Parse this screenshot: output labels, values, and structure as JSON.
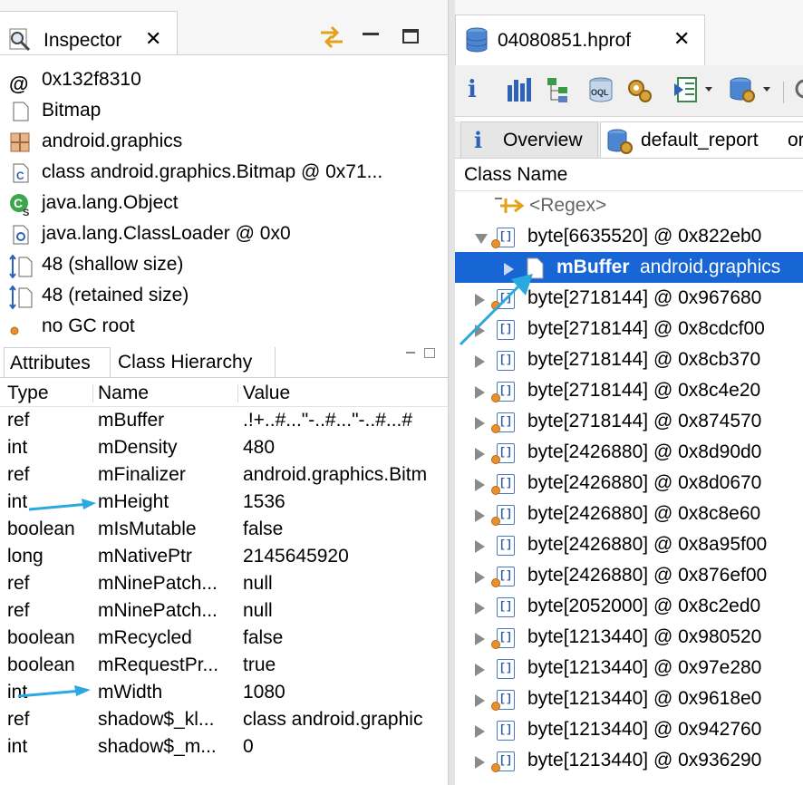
{
  "inspector": {
    "tab_title": "Inspector",
    "object_info": [
      {
        "icon": "at-icon",
        "text": "0x132f8310"
      },
      {
        "icon": "file-icon",
        "text": "Bitmap"
      },
      {
        "icon": "package-icon",
        "text": "android.graphics"
      },
      {
        "icon": "class-file-icon",
        "text": "class android.graphics.Bitmap @ 0x71..."
      },
      {
        "icon": "superclass-icon",
        "text": "java.lang.Object"
      },
      {
        "icon": "classloader-icon",
        "text": "java.lang.ClassLoader @ 0x0"
      },
      {
        "icon": "shallow-size-icon",
        "text": "48 (shallow size)"
      },
      {
        "icon": "retained-size-icon",
        "text": "48 (retained size)"
      },
      {
        "icon": "gc-root-dot-icon",
        "text": "no GC root"
      }
    ],
    "subtabs": [
      "Attributes",
      "Class Hierarchy"
    ],
    "table": {
      "headers": [
        "Type",
        "Name",
        "Value"
      ],
      "rows": [
        [
          "ref",
          "mBuffer",
          ".!+..#...\"-..#...\"-..#...#"
        ],
        [
          "int",
          "mDensity",
          "480"
        ],
        [
          "ref",
          "mFinalizer",
          "android.graphics.Bitm"
        ],
        [
          "int",
          "mHeight",
          "1536"
        ],
        [
          "boolean",
          "mIsMutable",
          "false"
        ],
        [
          "long",
          "mNativePtr",
          "2145645920"
        ],
        [
          "ref",
          "mNinePatch...",
          "null"
        ],
        [
          "ref",
          "mNinePatch...",
          "null"
        ],
        [
          "boolean",
          "mRecycled",
          "false"
        ],
        [
          "boolean",
          "mRequestPr...",
          "true"
        ],
        [
          "int",
          "mWidth",
          "1080"
        ],
        [
          "ref",
          "shadow$_kl...",
          "class android.graphic"
        ],
        [
          "int",
          "shadow$_m...",
          "0"
        ]
      ]
    }
  },
  "hprof": {
    "tab_title": "04080851.hprof",
    "toolbar": [
      "info-icon",
      "histogram-icon",
      "dominator-tree-icon",
      "oql-icon",
      "gear-icon",
      "run-report-icon",
      "heap-dump-icon",
      "search-icon"
    ],
    "editor_tabs": [
      {
        "label": "Overview",
        "icon": "info-icon"
      },
      {
        "label": "default_report",
        "icon": "report-icon"
      },
      {
        "label": "or",
        "icon": ""
      }
    ],
    "column_header": "Class Name",
    "regex_placeholder": "<Regex>",
    "rows": [
      {
        "text": "byte[6635520] @ 0x822eb0",
        "expanded": true,
        "level": 0,
        "dot": true
      },
      {
        "bold": "mBuffer",
        "text": " android.graphics",
        "level": 1,
        "selected": true
      },
      {
        "text": "byte[2718144] @ 0x967680",
        "level": 0,
        "dot": true
      },
      {
        "text": "byte[2718144] @ 0x8cdcf00",
        "level": 0,
        "dot": false
      },
      {
        "text": "byte[2718144] @ 0x8cb370",
        "level": 0,
        "dot": false
      },
      {
        "text": "byte[2718144] @ 0x8c4e20",
        "level": 0,
        "dot": true
      },
      {
        "text": "byte[2718144] @ 0x874570",
        "level": 0,
        "dot": true
      },
      {
        "text": "byte[2426880] @ 0x8d90d0",
        "level": 0,
        "dot": true
      },
      {
        "text": "byte[2426880] @ 0x8d0670",
        "level": 0,
        "dot": true
      },
      {
        "text": "byte[2426880] @ 0x8c8e60",
        "level": 0,
        "dot": true
      },
      {
        "text": "byte[2426880] @ 0x8a95f00",
        "level": 0,
        "dot": false
      },
      {
        "text": "byte[2426880] @ 0x876ef00",
        "level": 0,
        "dot": true
      },
      {
        "text": "byte[2052000] @ 0x8c2ed0",
        "level": 0,
        "dot": false
      },
      {
        "text": "byte[1213440] @ 0x980520",
        "level": 0,
        "dot": true
      },
      {
        "text": "byte[1213440] @ 0x97e280",
        "level": 0,
        "dot": false
      },
      {
        "text": "byte[1213440] @ 0x9618e0",
        "level": 0,
        "dot": true
      },
      {
        "text": "byte[1213440] @ 0x942760",
        "level": 0,
        "dot": false
      },
      {
        "text": "byte[1213440] @ 0x936290",
        "level": 0,
        "dot": true
      }
    ]
  },
  "colors": {
    "selection": "#1866d6",
    "annotation_arrow": "#2aa9e0"
  }
}
